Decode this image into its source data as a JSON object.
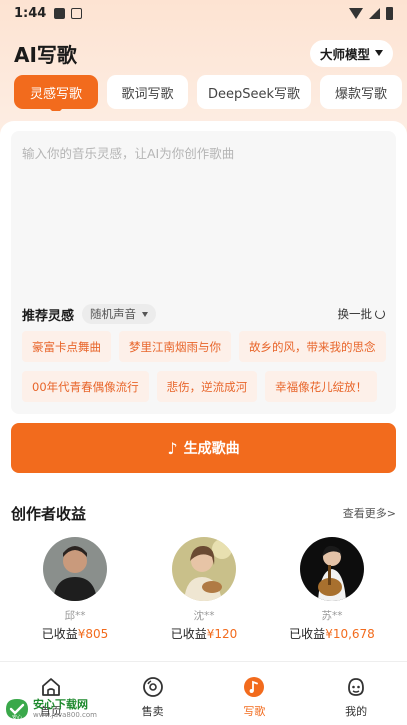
{
  "status_bar": {
    "time": "1:44"
  },
  "header": {
    "title": "AI写歌",
    "model_label": "大师模型"
  },
  "tabs": [
    {
      "label": "灵感写歌",
      "active": true
    },
    {
      "label": "歌词写歌",
      "active": false
    },
    {
      "label": "DeepSeek写歌",
      "active": false
    },
    {
      "label": "爆款写歌",
      "active": false
    }
  ],
  "prompt": {
    "placeholder": "输入你的音乐灵感，让AI为你创作歌曲",
    "value": ""
  },
  "recommend": {
    "title": "推荐灵感",
    "voice": "随机声音",
    "refresh": "换一批",
    "chips": [
      [
        "豪富卡点舞曲",
        "梦里江南烟雨与你",
        "故乡的风，带来我的思念"
      ],
      [
        "00年代青春偶像流行",
        "悲伤，逆流成河",
        "幸福像花儿绽放！"
      ]
    ]
  },
  "generate": {
    "label": "生成歌曲"
  },
  "creators": {
    "title": "创作者收益",
    "more": "查看更多>",
    "earn_prefix": "已收益",
    "items": [
      {
        "name": "邱**",
        "amount": "¥805"
      },
      {
        "name": "沈**",
        "amount": "¥120"
      },
      {
        "name": "苏**",
        "amount": "¥10,678"
      }
    ]
  },
  "bottom_nav": [
    {
      "label": "首页",
      "icon": "home-icon",
      "active": false
    },
    {
      "label": "售卖",
      "icon": "disc-icon",
      "active": false
    },
    {
      "label": "写歌",
      "icon": "music-note-icon",
      "active": true
    },
    {
      "label": "我的",
      "icon": "profile-icon",
      "active": false
    }
  ],
  "watermark": {
    "title": "安心下载网",
    "url": "www.java800.com",
    "badge": "安心"
  },
  "colors": {
    "accent": "#f26b1d",
    "chip_bg": "#fdf0e9",
    "header_bg": "#fde3d2"
  }
}
